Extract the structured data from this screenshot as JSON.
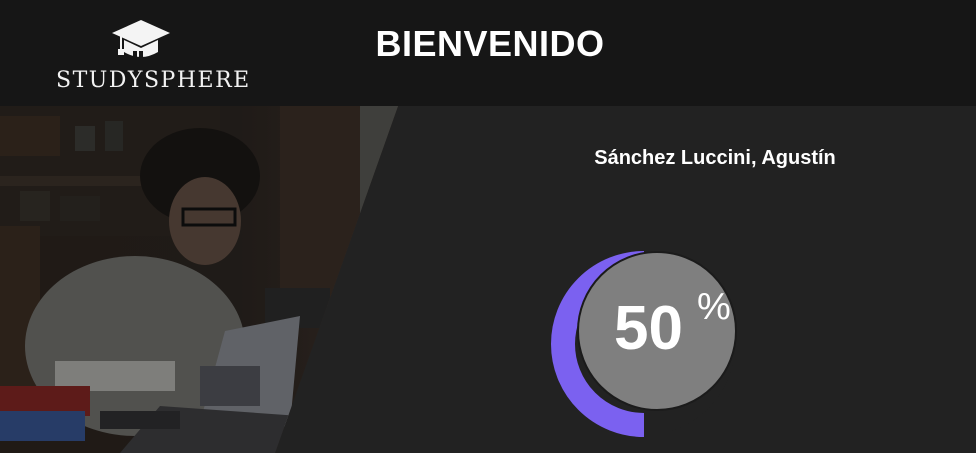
{
  "brand": {
    "name": "STUDYSPHERE",
    "icon": "graduation-cap-icon"
  },
  "header": {
    "welcome": "BIENVENIDO"
  },
  "user": {
    "name": "Sánchez Luccini, Agustín"
  },
  "progress": {
    "percent": 50,
    "value_label": "50",
    "unit_label": "%",
    "accent_color": "#7b61f0",
    "inner_color": "#7f7f7f"
  },
  "hero": {
    "image": "student-studying-photo"
  }
}
